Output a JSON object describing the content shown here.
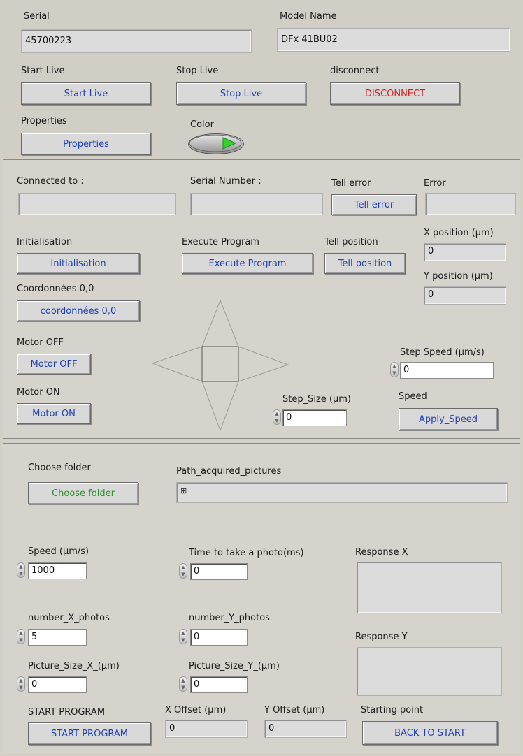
{
  "top": {
    "serial_label": "Serial",
    "serial_value": "45700223",
    "model_label": "Model Name",
    "model_value": "DFx 41BU02",
    "start_live_label": "Start Live",
    "start_live_button": "Start Live",
    "stop_live_label": "Stop Live",
    "stop_live_button": "Stop Live",
    "disconnect_label": "disconnect",
    "disconnect_button": "DISCONNECT",
    "properties_label": "Properties",
    "properties_button": "Properties",
    "color_label": "Color",
    "color_state": "on"
  },
  "stage": {
    "connected_label": "Connected to :",
    "connected_value": "",
    "serial_number_label": "Serial Number :",
    "serial_number_value": "",
    "tell_error_label": "Tell error",
    "tell_error_button": "Tell error",
    "error_label": "Error",
    "error_value": "",
    "initialisation_label": "Initialisation",
    "initialisation_button": "Initialisation",
    "execute_label": "Execute Program",
    "execute_button": "Execute Program",
    "tell_position_label": "Tell position",
    "tell_position_button": "Tell position",
    "x_position_label": "X position (µm)",
    "x_position_value": "0",
    "y_position_label": "Y position (µm)",
    "y_position_value": "0",
    "coords_label": "Coordonnées 0,0",
    "coords_button": "coordonnées 0,0",
    "motor_off_label": "Motor OFF",
    "motor_off_button": "Motor OFF",
    "motor_on_label": "Motor ON",
    "motor_on_button": "Motor ON",
    "step_speed_label": "Step Speed (µm/s)",
    "step_speed_value": "0",
    "step_size_label": "Step_Size (µm)",
    "step_size_value": "0",
    "speed_label": "Speed",
    "apply_speed_button": "Apply_Speed"
  },
  "program": {
    "choose_folder_label": "Choose folder",
    "choose_folder_button": "Choose folder",
    "path_label": "Path_acquired_pictures",
    "path_value": "",
    "speed_label": "Speed (µm/s)",
    "speed_value": "1000",
    "time_label": "Time to take a photo(ms)",
    "time_value": "0",
    "response_x_label": "Response X",
    "response_x_value": "",
    "num_x_label": "number_X_photos",
    "num_x_value": "5",
    "num_y_label": "number_Y_photos",
    "num_y_value": "0",
    "response_y_label": "Response Y",
    "response_y_value": "",
    "pic_x_label": "Picture_Size_X_(µm)",
    "pic_x_value": "0",
    "pic_y_label": "Picture_Size_Y_(µm)",
    "pic_y_value": "0",
    "start_program_label": "START PROGRAM",
    "start_program_button": "START PROGRAM",
    "x_offset_label": "X Offset (µm)",
    "x_offset_value": "0",
    "y_offset_label": "Y Offset (µm)",
    "y_offset_value": "0",
    "starting_point_label": "Starting point",
    "back_to_start_button": "BACK TO START"
  },
  "colors": {
    "button_text": "#1f3fb8",
    "disconnect_text": "#d22323",
    "choose_folder_text": "#2f8f2f",
    "led_on": "#35d12e"
  }
}
